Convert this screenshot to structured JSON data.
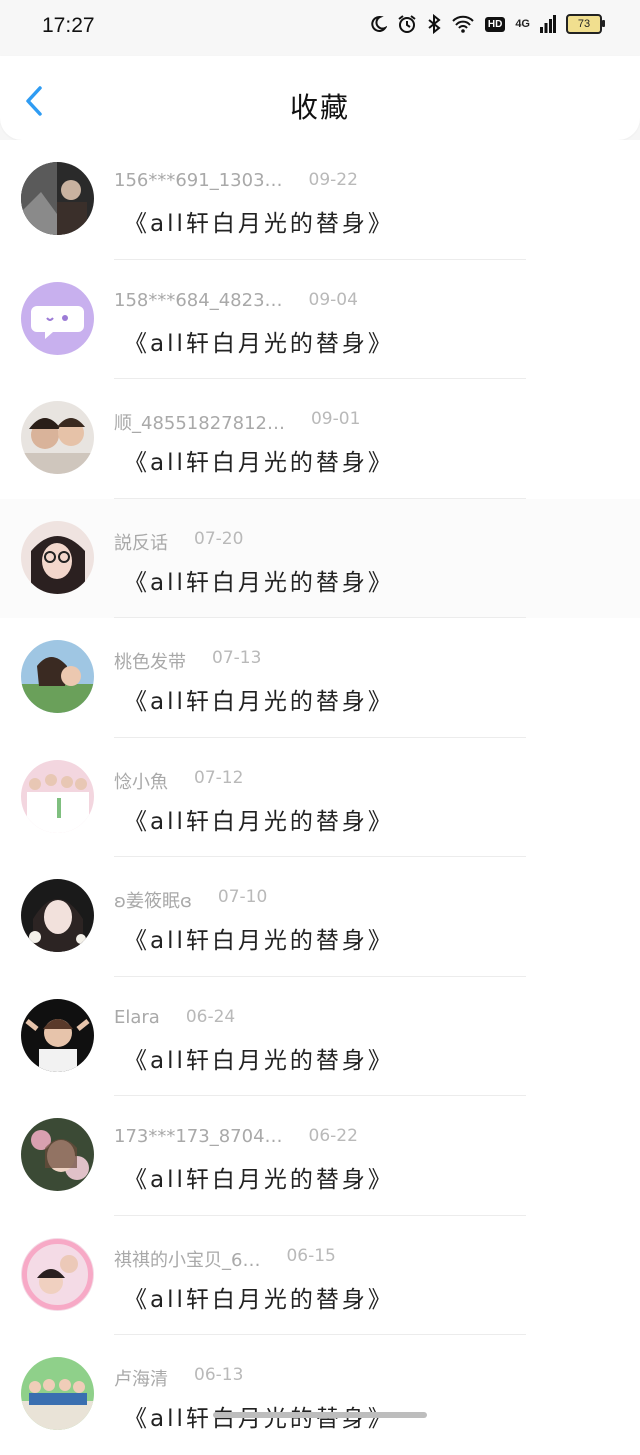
{
  "status_bar": {
    "time": "17:27",
    "hd_label": "HD",
    "network": "4G",
    "battery": "73"
  },
  "nav": {
    "title": "收藏"
  },
  "colors": {
    "accent": "#2f9cf3"
  },
  "items": [
    {
      "name": "156***691_1303…",
      "date": "09-22",
      "title": "《all轩白月光的替身》"
    },
    {
      "name": "158***684_4823…",
      "date": "09-04",
      "title": "《all轩白月光的替身》"
    },
    {
      "name": "顺_48551827812…",
      "date": "09-01",
      "title": "《all轩白月光的替身》"
    },
    {
      "name": "説反话",
      "date": "07-20",
      "title": "《all轩白月光的替身》"
    },
    {
      "name": "桃色发带",
      "date": "07-13",
      "title": "《all轩白月光的替身》"
    },
    {
      "name": "惗小魚",
      "date": "07-12",
      "title": "《all轩白月光的替身》"
    },
    {
      "name": "ʚ姜筱眠ɞ",
      "date": "07-10",
      "title": "《all轩白月光的替身》"
    },
    {
      "name": "Elara",
      "date": "06-24",
      "title": "《all轩白月光的替身》"
    },
    {
      "name": "173***173_8704…",
      "date": "06-22",
      "title": "《all轩白月光的替身》"
    },
    {
      "name": "祺祺的小宝贝_6…",
      "date": "06-15",
      "title": "《all轩白月光的替身》"
    },
    {
      "name": "卢海清",
      "date": "06-13",
      "title": "《all轩白月光的替身》"
    }
  ]
}
